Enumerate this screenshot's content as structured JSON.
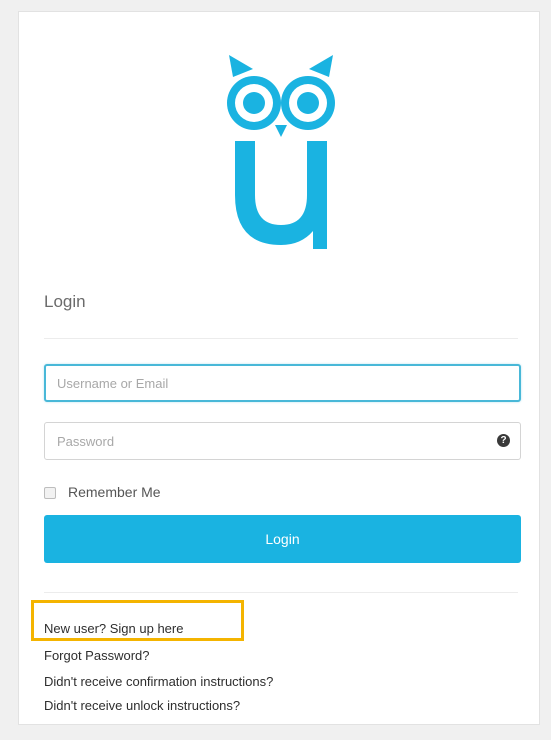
{
  "logo": {
    "icon": "owl-u-logo-icon",
    "color": "#1ab3e1"
  },
  "form": {
    "heading": "Login",
    "username_placeholder": "Username or Email",
    "password_placeholder": "Password",
    "password_help_icon": "question-circle-icon",
    "password_help_glyph": "?",
    "remember_label": "Remember Me",
    "login_button_label": "Login",
    "button_color": "#1ab3e1"
  },
  "links": {
    "signup": "New user? Sign up here",
    "forgot_password": "Forgot Password?",
    "resend_confirmation": "Didn't receive confirmation instructions?",
    "resend_unlock": "Didn't receive unlock instructions?"
  },
  "annotation": {
    "highlight_color": "#f4b400"
  }
}
